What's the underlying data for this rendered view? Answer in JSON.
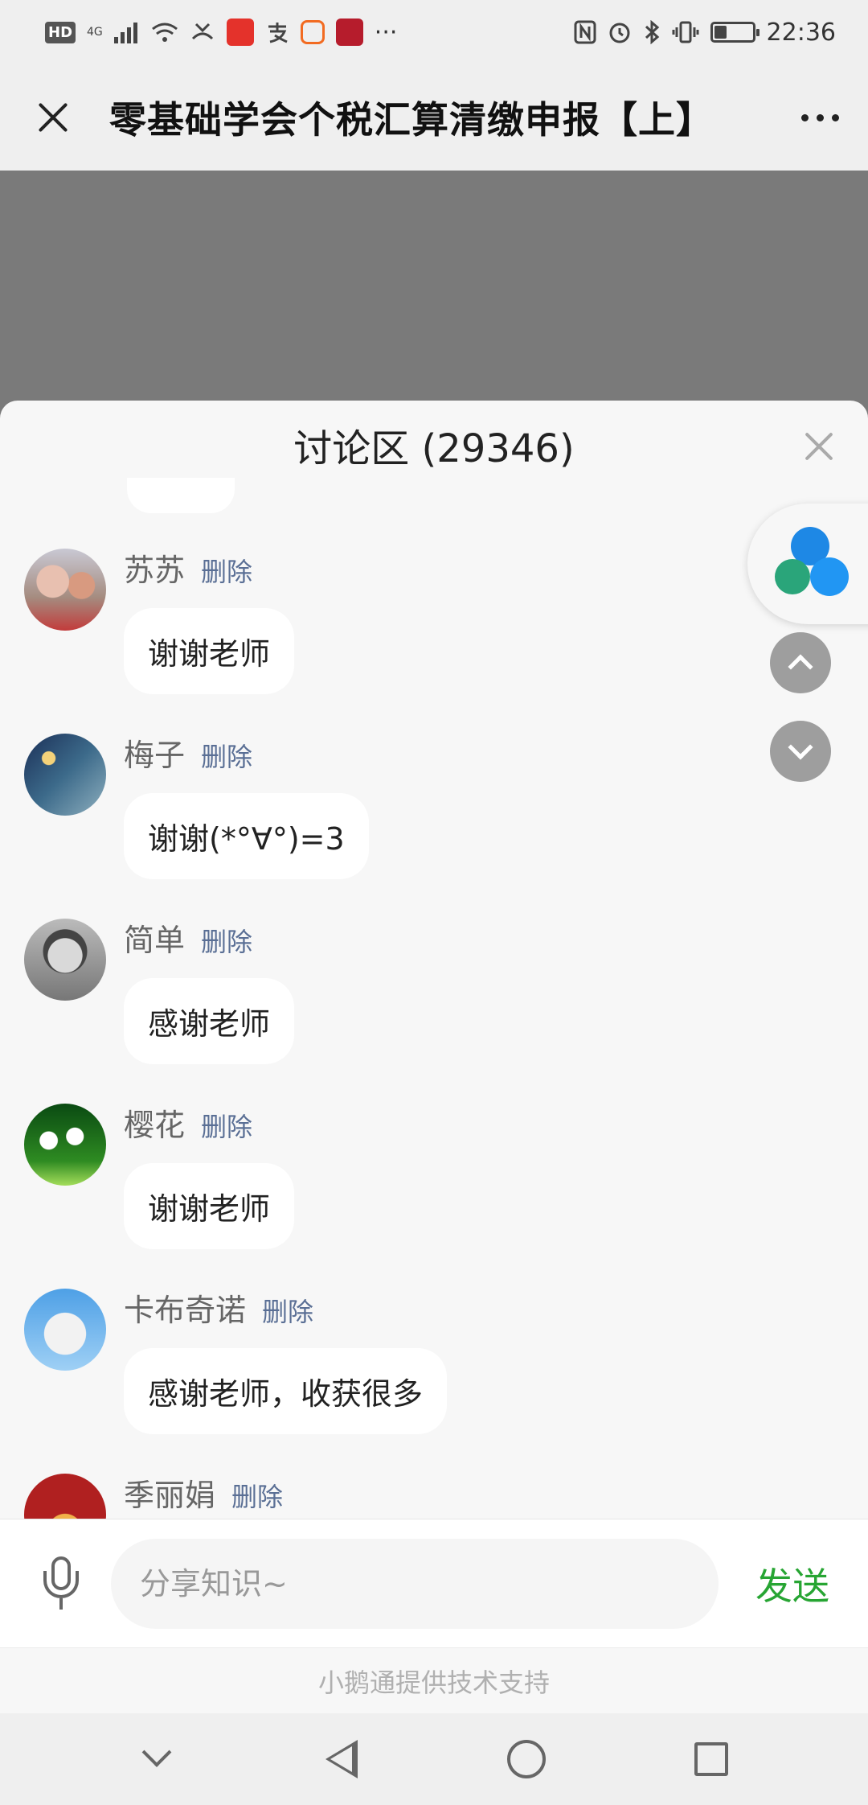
{
  "status_bar": {
    "hd": "HD",
    "network": "4G",
    "more": "···",
    "time": "22:36"
  },
  "header": {
    "title": "零基础学会个税汇算清缴申报【上】",
    "close_icon": "close-icon",
    "more_icon": "more-icon"
  },
  "discussion": {
    "title": "讨论区 (29346)",
    "delete_label": "删除",
    "messages": [
      {
        "name": "苏苏",
        "text": "谢谢老师"
      },
      {
        "name": "梅子",
        "text": "谢谢(*°∀°)=3"
      },
      {
        "name": "简单",
        "text": "感谢老师"
      },
      {
        "name": "樱花",
        "text": "谢谢老师"
      },
      {
        "name": "卡布奇诺",
        "text": "感谢老师，收获很多"
      },
      {
        "name": "季丽娟",
        "text": ""
      }
    ]
  },
  "input": {
    "placeholder": "分享知识~",
    "send_label": "发送"
  },
  "footer": {
    "powered_by": "小鹅通提供技术支持"
  },
  "colors": {
    "accent_green": "#27a533",
    "delete_blue": "#5a6f95",
    "overlay_gray": "#7a7a7a"
  }
}
